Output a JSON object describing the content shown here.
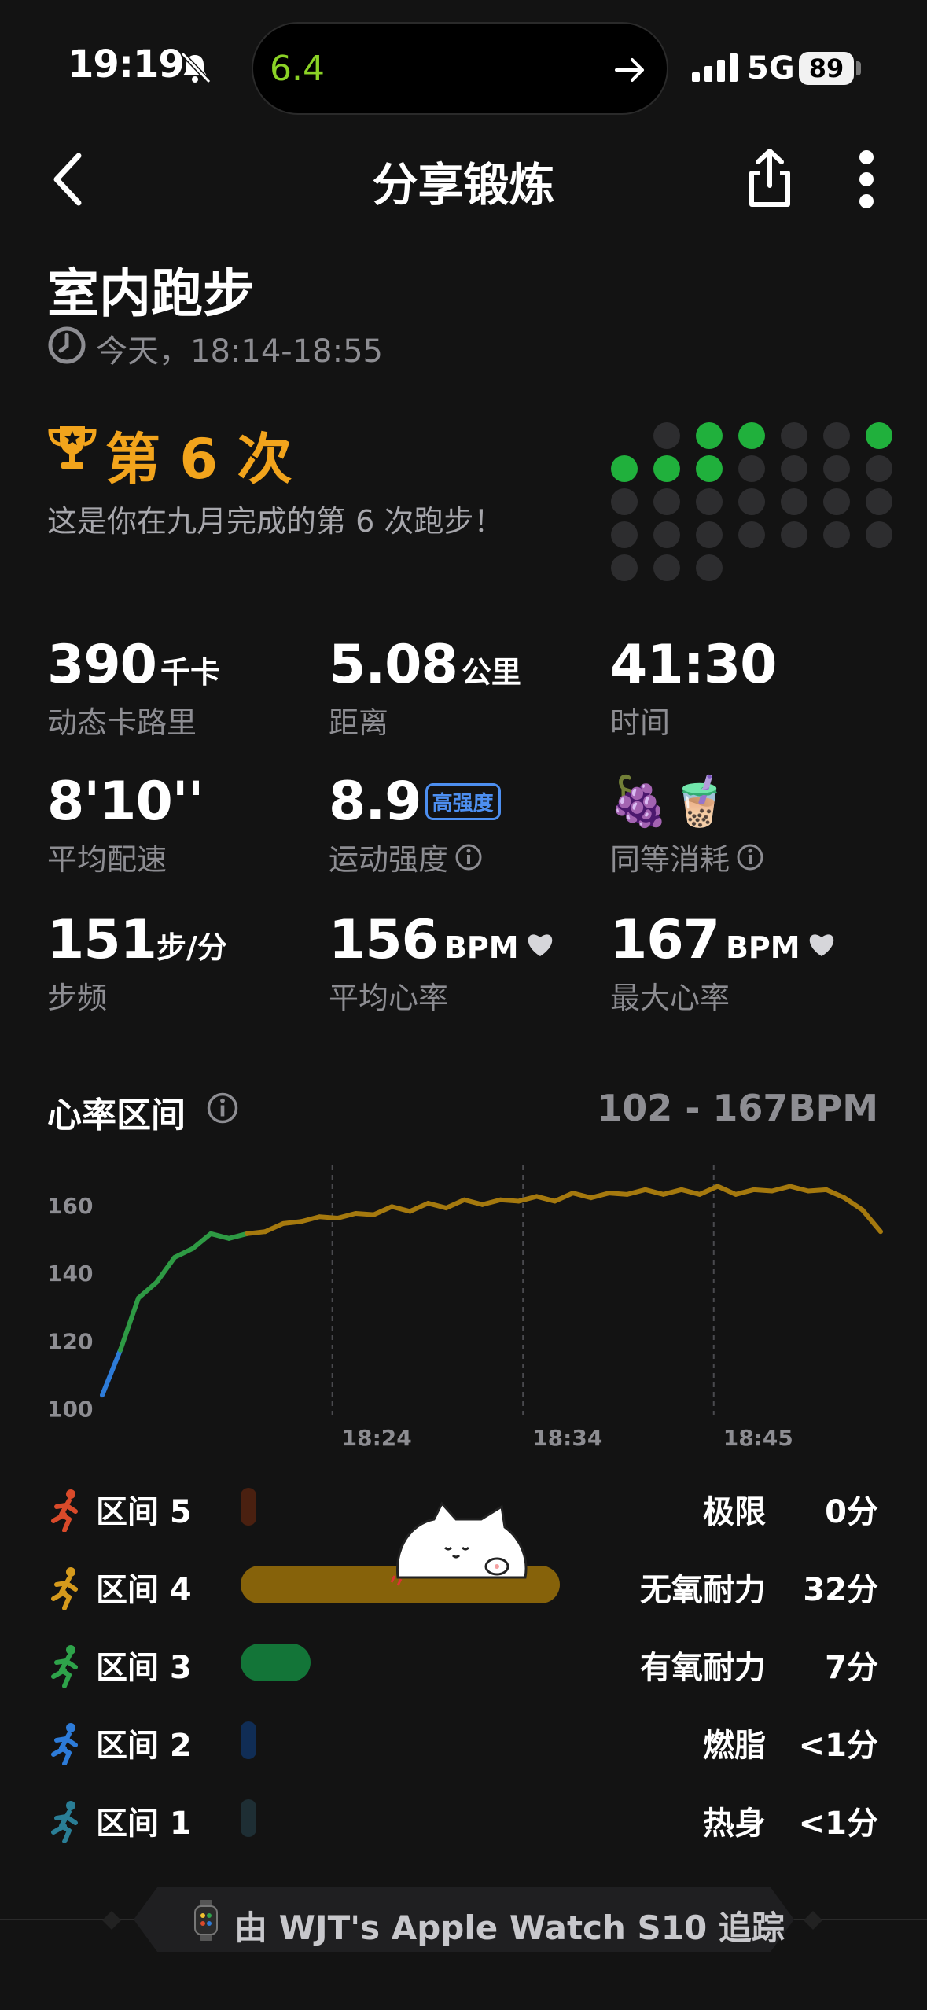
{
  "status_bar": {
    "time": "19:19",
    "island_value": "6.4",
    "network": "5G",
    "battery": "89"
  },
  "nav": {
    "title": "分享锻炼"
  },
  "workout": {
    "title": "室内跑步",
    "time": "今天，18:14-18:55"
  },
  "achievement": {
    "title": "第 6 次",
    "description": "这是你在九月完成的第 6 次跑步！"
  },
  "metrics": {
    "calories": {
      "value": "390",
      "unit": "千卡",
      "label": "动态卡路里"
    },
    "distance": {
      "value": "5.08",
      "unit": "公里",
      "label": "距离"
    },
    "duration": {
      "value": "41:30",
      "label": "时间"
    },
    "pace": {
      "value": "8'10''",
      "label": "平均配速"
    },
    "intensity": {
      "value": "8.9",
      "badge": "高强度",
      "label": "运动强度"
    },
    "equivalent": {
      "emoji": "🍇🧋",
      "label": "同等消耗"
    },
    "cadence": {
      "value": "151",
      "unit": "步/分",
      "label": "步频"
    },
    "avg_hr": {
      "value": "156",
      "unit": "BPM",
      "label": "平均心率"
    },
    "max_hr": {
      "value": "167",
      "unit": "BPM",
      "label": "最大心率"
    }
  },
  "hr_section": {
    "title": "心率区间",
    "range": "102 - 167BPM"
  },
  "chart_data": {
    "type": "line",
    "yticks": [
      "160",
      "140",
      "120",
      "100"
    ],
    "ylim": [
      98,
      170
    ],
    "xticks": [
      "18:24",
      "18:34",
      "18:45"
    ],
    "x": [
      "18:14",
      "18:14:30",
      "18:15",
      "18:15:30",
      "18:16",
      "18:17",
      "18:18",
      "18:19",
      "18:20",
      "18:21",
      "18:22",
      "18:23",
      "18:24",
      "18:25",
      "18:26",
      "18:27",
      "18:28",
      "18:29",
      "18:30",
      "18:31",
      "18:32",
      "18:33",
      "18:34",
      "18:35",
      "18:36",
      "18:37",
      "18:38",
      "18:39",
      "18:40",
      "18:41",
      "18:42",
      "18:43",
      "18:44",
      "18:45",
      "18:46",
      "18:47",
      "18:48",
      "18:49",
      "18:50",
      "18:51",
      "18:52",
      "18:53",
      "18:54",
      "18:55"
    ],
    "values": [
      104,
      118,
      132,
      138,
      144,
      148,
      151,
      151,
      151,
      153,
      154,
      156,
      156,
      157,
      157,
      158,
      159,
      159,
      160,
      160,
      161,
      161,
      161,
      162,
      162,
      162,
      163,
      163,
      163,
      164,
      164,
      164,
      164,
      164,
      165,
      164,
      164,
      165,
      165,
      165,
      164,
      163,
      158,
      153
    ]
  },
  "zones": [
    {
      "name": "区间 5",
      "type": "极限",
      "duration": "0分",
      "fraction": 0.0,
      "color": "#4a2010"
    },
    {
      "name": "区间 4",
      "type": "无氧耐力",
      "duration": "32分",
      "fraction": 1.0,
      "color": "#86620a"
    },
    {
      "name": "区间 3",
      "type": "有氧耐力",
      "duration": "7分",
      "fraction": 0.22,
      "color": "#137538"
    },
    {
      "name": "区间 2",
      "type": "燃脂",
      "duration": "<1分",
      "fraction": 0.02,
      "color": "#102d55"
    },
    {
      "name": "区间 1",
      "type": "热身",
      "duration": "<1分",
      "fraction": 0.02,
      "color": "#1e2e34"
    }
  ],
  "zone_icon_colors": [
    "#d94a2a",
    "#d59a1c",
    "#2ea34a",
    "#2d7bd8",
    "#2a7e96"
  ],
  "month_dots": {
    "leading_blanks": 1,
    "days": 30,
    "active_days": [
      2,
      3,
      6,
      7,
      8,
      9
    ]
  },
  "footer": {
    "text": "由 WJT's Apple Watch S10 追踪"
  },
  "colors": {
    "accent": "#f2a41c",
    "dot_active": "#20b03c",
    "dot_inactive": "#2d2d2f",
    "badge": "#4d8ff0"
  }
}
